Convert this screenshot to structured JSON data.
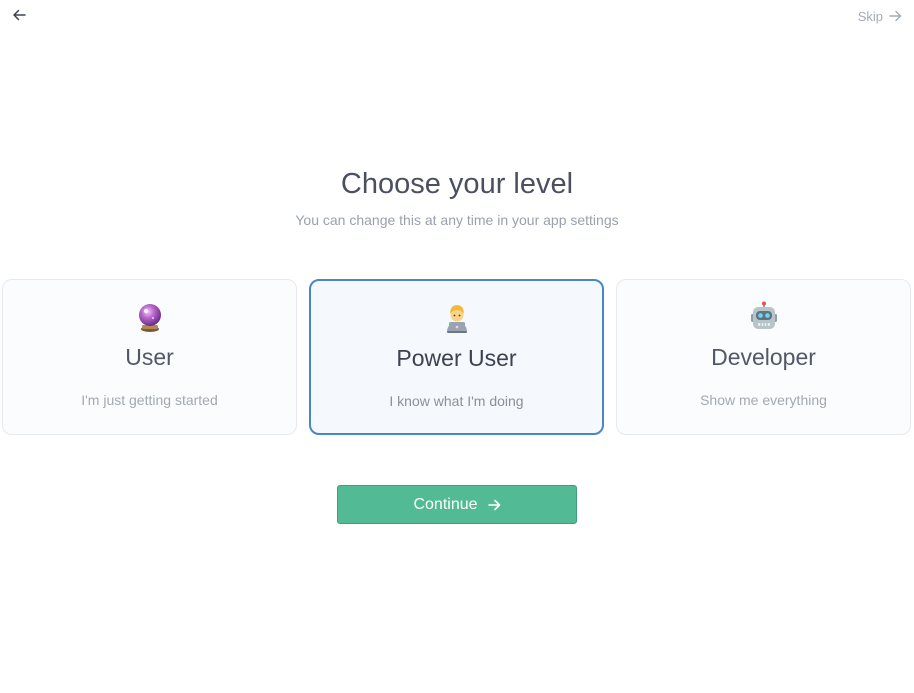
{
  "nav": {
    "back_icon": "arrow-left-icon",
    "skip_label": "Skip",
    "skip_icon": "arrow-right-icon"
  },
  "header": {
    "title": "Choose your level",
    "subtitle": "You can change this at any time in your app settings"
  },
  "levels": [
    {
      "icon": "crystal-ball-icon",
      "title": "User",
      "description": "I'm just getting started",
      "selected": false
    },
    {
      "icon": "technologist-icon",
      "title": "Power User",
      "description": "I know what I'm doing",
      "selected": true
    },
    {
      "icon": "robot-icon",
      "title": "Developer",
      "description": "Show me everything",
      "selected": false
    }
  ],
  "actions": {
    "continue_label": "Continue",
    "continue_icon": "arrow-right-icon"
  },
  "colors": {
    "accent": "#52bb95",
    "selected_border": "#4a87c8"
  }
}
